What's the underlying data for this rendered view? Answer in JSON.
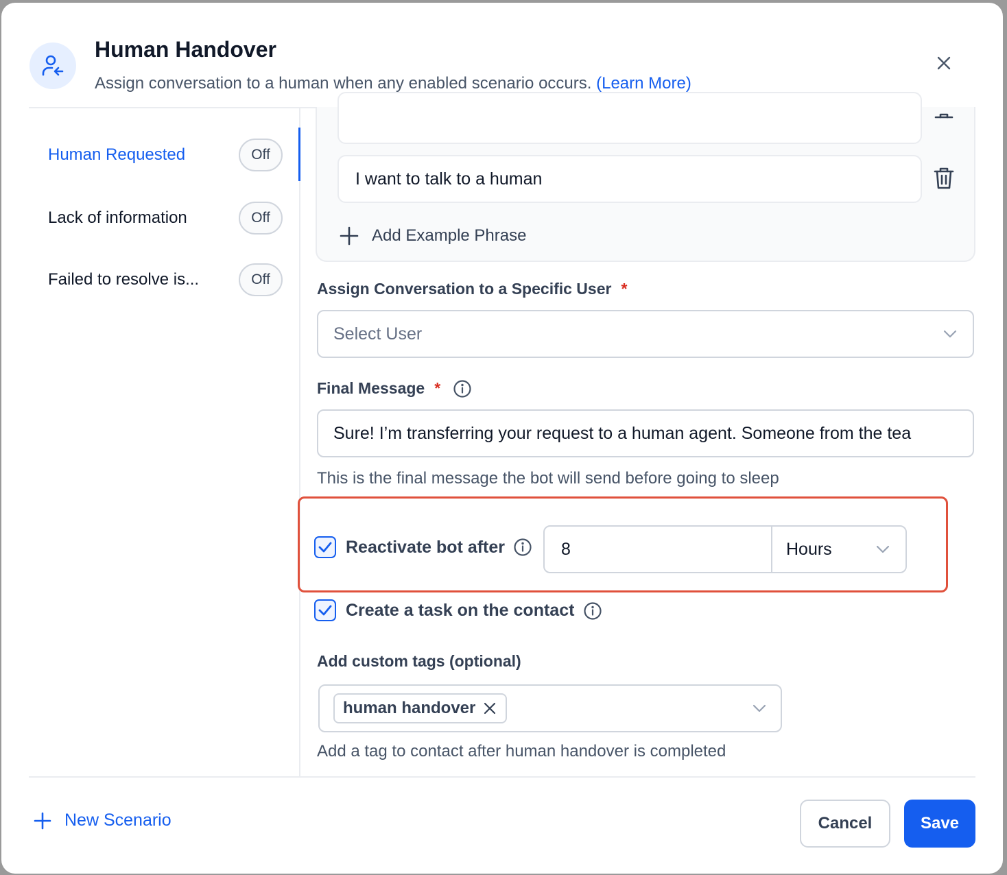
{
  "header": {
    "title": "Human Handover",
    "subtitle": "Assign conversation to a human when any enabled scenario occurs.",
    "learn_more": "(Learn More)",
    "icon": "user-arrow-icon"
  },
  "sidebar": {
    "items": [
      {
        "label": "Human Requested",
        "status": "Off",
        "active": true
      },
      {
        "label": "Lack of information",
        "status": "Off",
        "active": false
      },
      {
        "label": "Failed to resolve is...",
        "status": "Off",
        "active": false
      }
    ],
    "new_scenario": "New Scenario"
  },
  "phrases": {
    "items": [
      "",
      "I want to talk to a human"
    ],
    "add_label": "Add Example Phrase"
  },
  "assign_user": {
    "label": "Assign Conversation to a Specific User",
    "required": "*",
    "placeholder": "Select User"
  },
  "final_message": {
    "label": "Final Message",
    "required": "*",
    "value": "Sure! I’m transferring your request to a human agent. Someone from the tea",
    "help": "This is the final message the bot will send before going to sleep"
  },
  "reactivate": {
    "label": "Reactivate bot after",
    "checked": true,
    "value": "8",
    "unit": "Hours"
  },
  "create_task": {
    "label": "Create a task on the contact",
    "checked": true
  },
  "custom_tags": {
    "label": "Add custom tags (optional)",
    "tags": [
      "human handover"
    ],
    "help": "Add a tag to contact after human handover is completed"
  },
  "footer": {
    "cancel": "Cancel",
    "save": "Save"
  },
  "colors": {
    "accent": "#155eef",
    "highlight": "#e0513c",
    "required": "#d92d20"
  }
}
